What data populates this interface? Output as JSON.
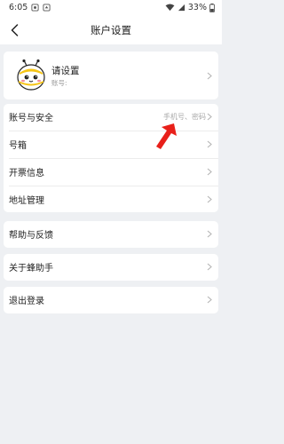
{
  "status": {
    "time": "6:05",
    "battery": "33%"
  },
  "nav": {
    "title": "账户设置"
  },
  "profile": {
    "name": "请设置",
    "account_label": "账号:"
  },
  "groups": [
    {
      "items": [
        {
          "label": "账号与安全",
          "hint": "手机号、密码"
        },
        {
          "label": "号箱",
          "hint": ""
        },
        {
          "label": "开票信息",
          "hint": ""
        },
        {
          "label": "地址管理",
          "hint": ""
        }
      ]
    },
    {
      "items": [
        {
          "label": "帮助与反馈"
        }
      ]
    },
    {
      "items": [
        {
          "label": "关于蜂助手"
        }
      ]
    },
    {
      "items": [
        {
          "label": "退出登录"
        }
      ]
    }
  ],
  "icons": {
    "back": "chevron-left-icon",
    "chevron": "chevron-right-icon",
    "annotation": "red-arrow-icon",
    "avatar": "bee-avatar"
  },
  "colors": {
    "background": "#eef0f3",
    "annotation": "#e8201a"
  }
}
